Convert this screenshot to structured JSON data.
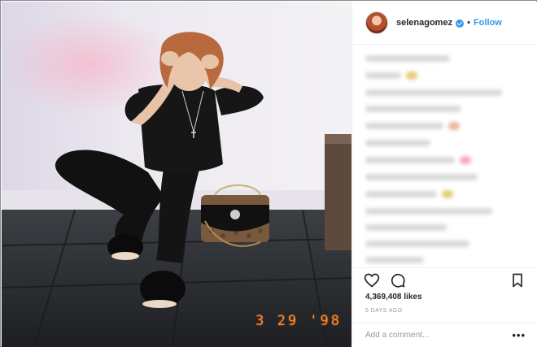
{
  "post": {
    "username": "selenagomez",
    "separator": "•",
    "follow_label": "Follow",
    "likes_text": "4,369,408 likes",
    "time_ago": "5 DAYS AGO",
    "comment_placeholder": "Add a comment...",
    "more_options": "•••",
    "photo_date_stamp": "3 29 '98"
  },
  "colors": {
    "accent": "#3897f0",
    "text": "#262626",
    "muted": "#999999",
    "date_stamp": "#ff8a2a"
  },
  "icons": {
    "verified": "verified-badge-icon",
    "like": "heart-icon",
    "comment": "comment-bubble-icon",
    "save": "bookmark-icon"
  }
}
